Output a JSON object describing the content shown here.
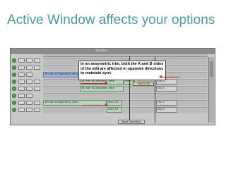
{
  "slide": {
    "title": "Active Window affects your options"
  },
  "editor": {
    "window_title": "Timeline",
    "callout": "In an assymetric trim, both the A and B sides of the edit are affected in opposite directions to maintain sync",
    "clips": [
      {
        "label": "3B Inter at Downtown_clkns",
        "color": "blue"
      },
      {
        "label": "Fade_03",
        "color": "blue"
      },
      {
        "label": "3B Inter at Downtown_clkns",
        "color": "green"
      },
      {
        "label": "Inter_04",
        "color": "green"
      },
      {
        "label": "Clip 2",
        "color": "gray"
      },
      {
        "label": "3B Inter at Downtown_clkns",
        "color": "green"
      },
      {
        "label": "Clip 2",
        "color": "gray"
      },
      {
        "label": "3B Inter at Downtown_clkns",
        "color": "green"
      },
      {
        "label": "Inter_04",
        "color": "green"
      },
      {
        "label": "Clip 2",
        "color": "gray"
      },
      {
        "label": "Inter_04",
        "color": "green"
      },
      {
        "label": "Clip 2",
        "color": "gray"
      }
    ],
    "trim_tag": "+00:00:00",
    "footer_clip": "Black Transition"
  },
  "colors": {
    "title": "#4a9a9a",
    "arrow": "#d11a1a",
    "clip_blue": "#9bb6df",
    "clip_green": "#b8d6b8",
    "led": "#4da24d"
  }
}
